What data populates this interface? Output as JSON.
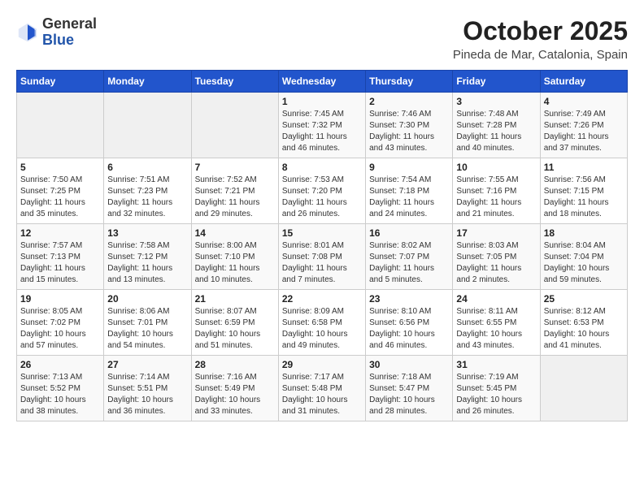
{
  "header": {
    "logo": {
      "general": "General",
      "blue": "Blue"
    },
    "title": "October 2025",
    "subtitle": "Pineda de Mar, Catalonia, Spain"
  },
  "weekdays": [
    "Sunday",
    "Monday",
    "Tuesday",
    "Wednesday",
    "Thursday",
    "Friday",
    "Saturday"
  ],
  "weeks": [
    [
      {
        "day": "",
        "empty": true
      },
      {
        "day": "",
        "empty": true
      },
      {
        "day": "",
        "empty": true
      },
      {
        "day": "1",
        "sunrise": "7:45 AM",
        "sunset": "7:32 PM",
        "daylight": "11 hours and 46 minutes."
      },
      {
        "day": "2",
        "sunrise": "7:46 AM",
        "sunset": "7:30 PM",
        "daylight": "11 hours and 43 minutes."
      },
      {
        "day": "3",
        "sunrise": "7:48 AM",
        "sunset": "7:28 PM",
        "daylight": "11 hours and 40 minutes."
      },
      {
        "day": "4",
        "sunrise": "7:49 AM",
        "sunset": "7:26 PM",
        "daylight": "11 hours and 37 minutes."
      }
    ],
    [
      {
        "day": "5",
        "sunrise": "7:50 AM",
        "sunset": "7:25 PM",
        "daylight": "11 hours and 35 minutes."
      },
      {
        "day": "6",
        "sunrise": "7:51 AM",
        "sunset": "7:23 PM",
        "daylight": "11 hours and 32 minutes."
      },
      {
        "day": "7",
        "sunrise": "7:52 AM",
        "sunset": "7:21 PM",
        "daylight": "11 hours and 29 minutes."
      },
      {
        "day": "8",
        "sunrise": "7:53 AM",
        "sunset": "7:20 PM",
        "daylight": "11 hours and 26 minutes."
      },
      {
        "day": "9",
        "sunrise": "7:54 AM",
        "sunset": "7:18 PM",
        "daylight": "11 hours and 24 minutes."
      },
      {
        "day": "10",
        "sunrise": "7:55 AM",
        "sunset": "7:16 PM",
        "daylight": "11 hours and 21 minutes."
      },
      {
        "day": "11",
        "sunrise": "7:56 AM",
        "sunset": "7:15 PM",
        "daylight": "11 hours and 18 minutes."
      }
    ],
    [
      {
        "day": "12",
        "sunrise": "7:57 AM",
        "sunset": "7:13 PM",
        "daylight": "11 hours and 15 minutes."
      },
      {
        "day": "13",
        "sunrise": "7:58 AM",
        "sunset": "7:12 PM",
        "daylight": "11 hours and 13 minutes."
      },
      {
        "day": "14",
        "sunrise": "8:00 AM",
        "sunset": "7:10 PM",
        "daylight": "11 hours and 10 minutes."
      },
      {
        "day": "15",
        "sunrise": "8:01 AM",
        "sunset": "7:08 PM",
        "daylight": "11 hours and 7 minutes."
      },
      {
        "day": "16",
        "sunrise": "8:02 AM",
        "sunset": "7:07 PM",
        "daylight": "11 hours and 5 minutes."
      },
      {
        "day": "17",
        "sunrise": "8:03 AM",
        "sunset": "7:05 PM",
        "daylight": "11 hours and 2 minutes."
      },
      {
        "day": "18",
        "sunrise": "8:04 AM",
        "sunset": "7:04 PM",
        "daylight": "10 hours and 59 minutes."
      }
    ],
    [
      {
        "day": "19",
        "sunrise": "8:05 AM",
        "sunset": "7:02 PM",
        "daylight": "10 hours and 57 minutes."
      },
      {
        "day": "20",
        "sunrise": "8:06 AM",
        "sunset": "7:01 PM",
        "daylight": "10 hours and 54 minutes."
      },
      {
        "day": "21",
        "sunrise": "8:07 AM",
        "sunset": "6:59 PM",
        "daylight": "10 hours and 51 minutes."
      },
      {
        "day": "22",
        "sunrise": "8:09 AM",
        "sunset": "6:58 PM",
        "daylight": "10 hours and 49 minutes."
      },
      {
        "day": "23",
        "sunrise": "8:10 AM",
        "sunset": "6:56 PM",
        "daylight": "10 hours and 46 minutes."
      },
      {
        "day": "24",
        "sunrise": "8:11 AM",
        "sunset": "6:55 PM",
        "daylight": "10 hours and 43 minutes."
      },
      {
        "day": "25",
        "sunrise": "8:12 AM",
        "sunset": "6:53 PM",
        "daylight": "10 hours and 41 minutes."
      }
    ],
    [
      {
        "day": "26",
        "sunrise": "7:13 AM",
        "sunset": "5:52 PM",
        "daylight": "10 hours and 38 minutes."
      },
      {
        "day": "27",
        "sunrise": "7:14 AM",
        "sunset": "5:51 PM",
        "daylight": "10 hours and 36 minutes."
      },
      {
        "day": "28",
        "sunrise": "7:16 AM",
        "sunset": "5:49 PM",
        "daylight": "10 hours and 33 minutes."
      },
      {
        "day": "29",
        "sunrise": "7:17 AM",
        "sunset": "5:48 PM",
        "daylight": "10 hours and 31 minutes."
      },
      {
        "day": "30",
        "sunrise": "7:18 AM",
        "sunset": "5:47 PM",
        "daylight": "10 hours and 28 minutes."
      },
      {
        "day": "31",
        "sunrise": "7:19 AM",
        "sunset": "5:45 PM",
        "daylight": "10 hours and 26 minutes."
      },
      {
        "day": "",
        "empty": true
      }
    ]
  ]
}
